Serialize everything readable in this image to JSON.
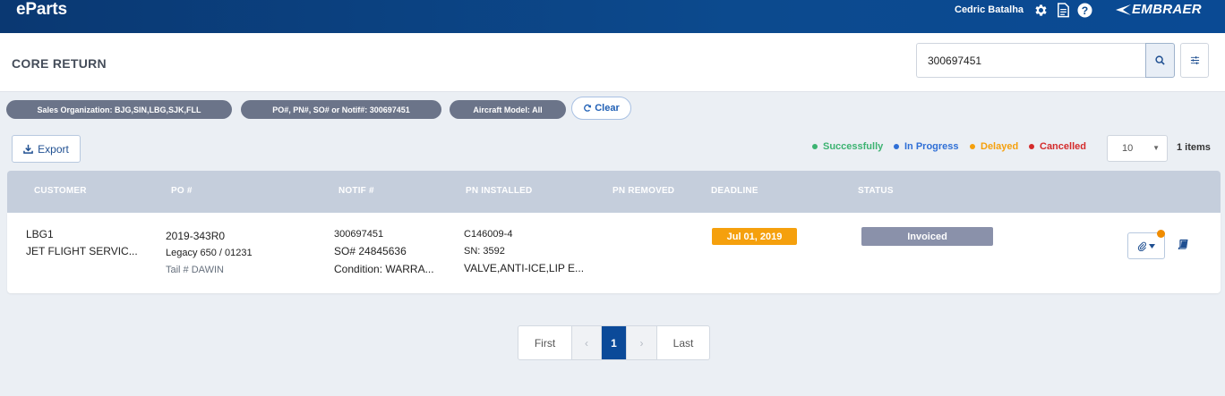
{
  "app": {
    "name": "eParts",
    "user": "Cedric Batalha",
    "logo_text": "EMBRAER"
  },
  "page": {
    "title": "CORE RETURN"
  },
  "search": {
    "value": "300697451",
    "placeholder": ""
  },
  "filters": [
    {
      "label": "Sales Organization: BJG,SIN,LBG,SJK,FLL"
    },
    {
      "label": "PO#, PN#, SO# or Notif#: 300697451"
    },
    {
      "label": "Aircraft Model: All"
    }
  ],
  "clear_label": "Clear",
  "export_label": "Export",
  "legend": [
    {
      "label": "Successfully",
      "color": "#3cb371"
    },
    {
      "label": "In Progress",
      "color": "#2f6fd6"
    },
    {
      "label": "Delayed",
      "color": "#f5a00d"
    },
    {
      "label": "Cancelled",
      "color": "#d42b2b"
    }
  ],
  "page_size": "10",
  "item_count": "1 items",
  "table": {
    "headers": [
      "CUSTOMER",
      "PO #",
      "NOTIF #",
      "PN INSTALLED",
      "PN REMOVED",
      "DEADLINE",
      "STATUS"
    ],
    "rows": [
      {
        "customer_code": "LBG1",
        "customer_name": "JET FLIGHT SERVIC...",
        "po": "2019-343R0",
        "aircraft": "Legacy 650 / 01231",
        "tail": "Tail # DAWIN",
        "notif": "300697451",
        "so": "SO# 24845636",
        "condition": "Condition: WARRA...",
        "pn_installed": "C146009-4",
        "sn": "SN: 3592",
        "description": "VALVE,ANTI-ICE,LIP E...",
        "pn_removed": "",
        "deadline": "Jul 01, 2019",
        "status": "Invoiced"
      }
    ]
  },
  "pagination": {
    "first": "First",
    "prev": "‹",
    "current": "1",
    "next": "›",
    "last": "Last"
  },
  "colors": {
    "header": "#0c4a8e",
    "accent": "#0b4a99",
    "deadline": "#f5a00d",
    "status": "#8a91aa"
  }
}
